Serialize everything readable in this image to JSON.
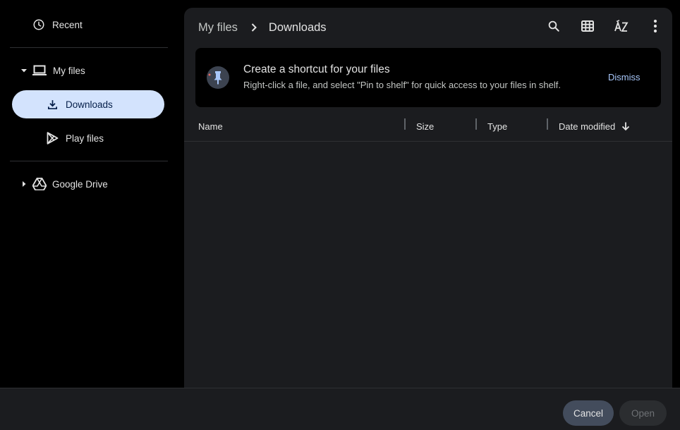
{
  "sidebar": {
    "recent_label": "Recent",
    "my_files_label": "My files",
    "downloads_label": "Downloads",
    "play_files_label": "Play files",
    "google_drive_label": "Google Drive",
    "icons": {
      "recent": "clock-icon",
      "my_files_expand": "caret-down-icon",
      "my_files": "laptop-icon",
      "downloads": "download-icon",
      "play_files": "play-store-icon",
      "google_drive_expand": "caret-right-icon",
      "google_drive": "google-drive-icon"
    }
  },
  "header": {
    "breadcrumb_root": "My files",
    "breadcrumb_current": "Downloads",
    "toolbar_icons": [
      "search-icon",
      "grid-view-icon",
      "sort-az-icon",
      "more-vert-icon"
    ]
  },
  "banner": {
    "title": "Create a shortcut for your files",
    "description": "Right-click a file, and select \"Pin to shelf\" for quick access to your files in shelf.",
    "dismiss_label": "Dismiss",
    "icon": "pin-icon"
  },
  "table": {
    "columns": [
      "Name",
      "Size",
      "Type",
      "Date modified"
    ],
    "sort_direction_icon": "arrow-down-icon",
    "rows": []
  },
  "footer": {
    "cancel_label": "Cancel",
    "open_label": "Open"
  },
  "colors": {
    "accent": "#a8c7fa",
    "selected_nav_bg": "#d3e3fd",
    "panel_bg": "#1b1c1f",
    "cancel_bg": "#434c5c"
  }
}
